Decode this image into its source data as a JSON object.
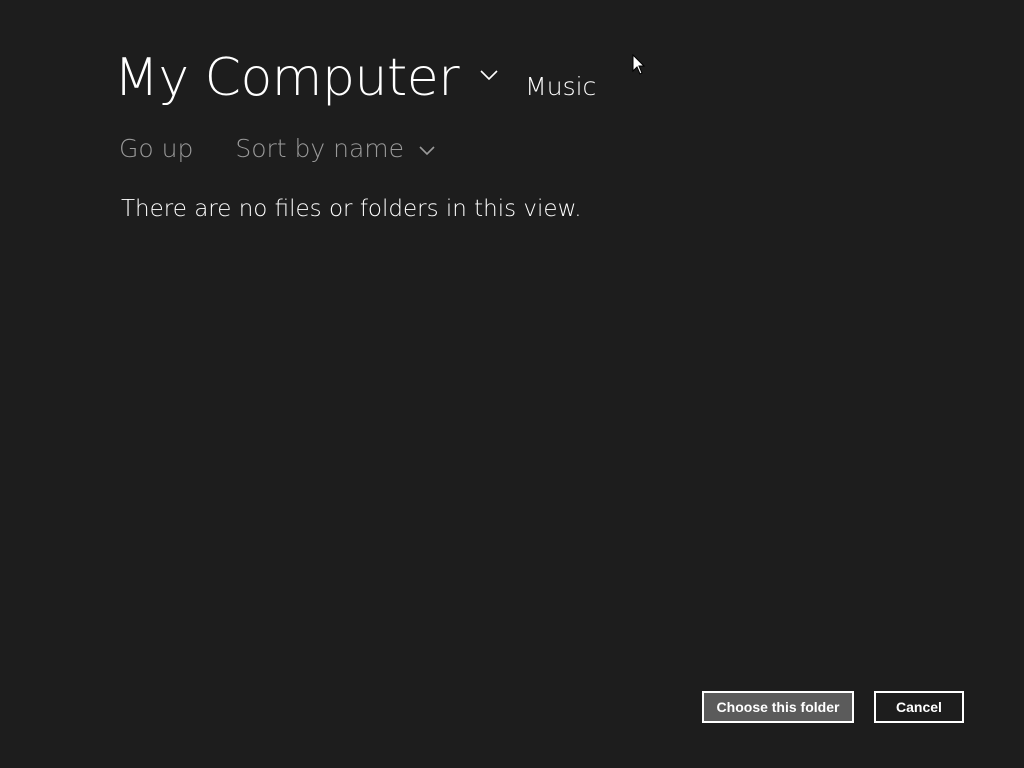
{
  "location": {
    "title": "My Computer",
    "subfolder": "Music"
  },
  "toolbar": {
    "go_up_label": "Go up",
    "sort_label": "Sort by name"
  },
  "content": {
    "empty_message": "There are no files or folders in this view."
  },
  "actions": {
    "choose_label": "Choose this folder",
    "cancel_label": "Cancel"
  },
  "icons": {
    "location_dropdown": "chevron-down-icon",
    "sort_dropdown": "chevron-down-icon",
    "cursor": "mouse-cursor-icon"
  },
  "colors": {
    "background": "#1d1d1d",
    "text_primary": "#ffffff",
    "text_secondary": "#9a9a9a",
    "primary_button_bg": "#5b5b5b"
  }
}
